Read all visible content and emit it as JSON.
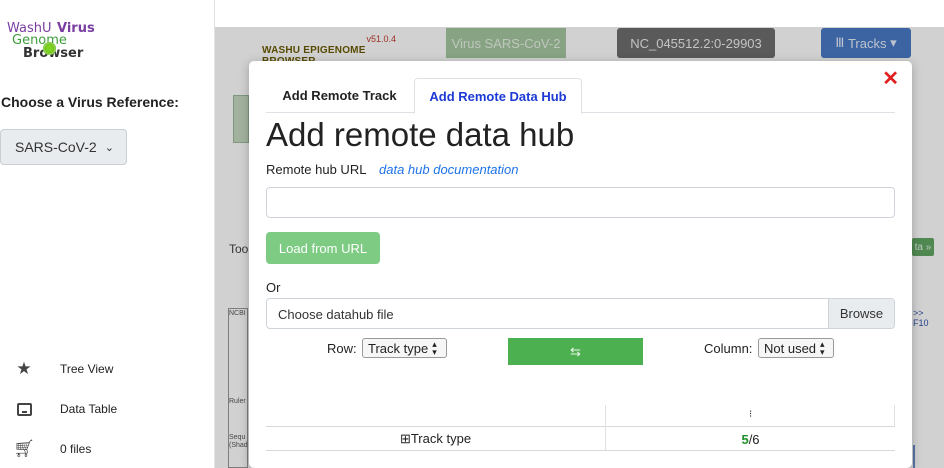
{
  "sidebar": {
    "logo": {
      "line1a": "WashU",
      "line1b": "Virus",
      "line2": "Genome",
      "line3": "Browser"
    },
    "choose_title": "Choose a Virus Reference:",
    "virus_selected": "SARS-CoV-2",
    "items": [
      {
        "label": "Tree View",
        "icon": "star-icon"
      },
      {
        "label": "Data Table",
        "icon": "monitor-icon"
      },
      {
        "label": "0 files",
        "icon": "cart-icon"
      }
    ]
  },
  "background": {
    "version": "v51.0.4",
    "brand": "WASHU EPIGENOME BROWSER",
    "virus_button": "Virus SARS-CoV-2",
    "coordinates": "NC_045512.2:0-29903",
    "tracks_button": "Tracks",
    "tool_label": "Too",
    "right_green": "ta »",
    "ncbi_label": "NCBI",
    "ruler_label": "Ruler",
    "seq_label_1": "Sequ",
    "seq_label_2": "(Shad",
    "right_box": "F10"
  },
  "modal": {
    "close": "✕",
    "tabs": [
      "Add Remote Track",
      "Add Remote Data Hub"
    ],
    "active_tab_index": 1,
    "title": "Add remote data hub",
    "url_label": "Remote hub URL",
    "doc_link": "data hub documentation",
    "url_value": "",
    "load_button": "Load from URL",
    "or_label": "Or",
    "file_placeholder": "Choose datahub file",
    "browse_button": "Browse",
    "row_label": "Row:",
    "row_value": "Track type",
    "swap_symbol": "⇆",
    "column_label": "Column:",
    "column_value": "Not used",
    "table": {
      "header_marker": "⁝",
      "row_label": "⊞Track type",
      "count_selected": "5",
      "count_total": "/6"
    }
  },
  "colors": {
    "tab_active": "#1d3ad6",
    "link": "#1e73e8",
    "close": "#e02020",
    "load_button": "#7ecb84",
    "swap_button": "#4caf50",
    "count_green": "#1f8f2b"
  }
}
